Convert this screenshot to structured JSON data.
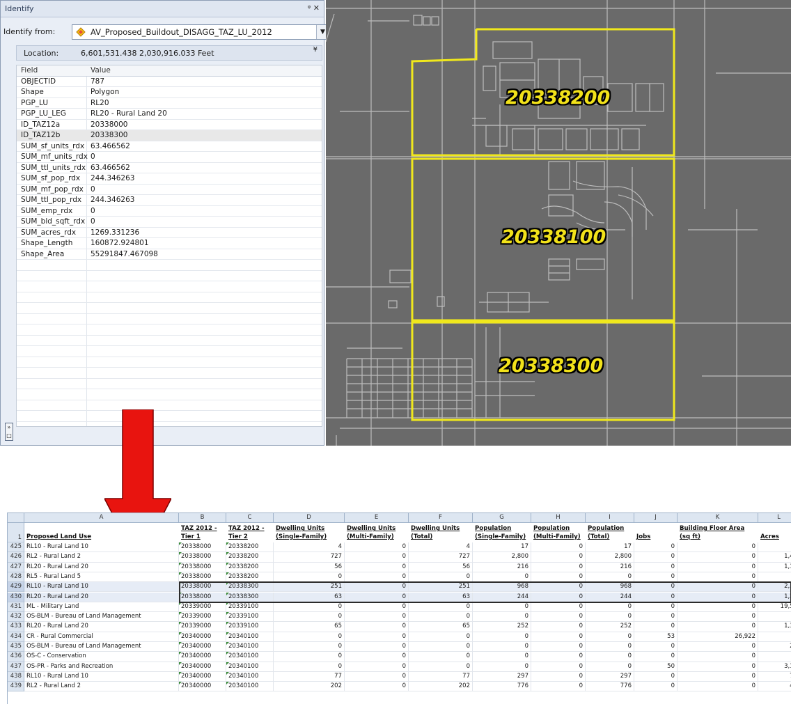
{
  "identify": {
    "title": "Identify",
    "title_buttons": " ↓ ×",
    "from_label": "Identify from:",
    "from_value": "AV_Proposed_Buildout_DISAGG_TAZ_LU_2012",
    "location_label": "Location:",
    "location_value": "6,601,531.438  2,030,916.033 Feet",
    "col_field": "Field",
    "col_value": "Value",
    "rows": [
      {
        "field": "OBJECTID",
        "value": "787"
      },
      {
        "field": "Shape",
        "value": "Polygon"
      },
      {
        "field": "PGP_LU",
        "value": "RL20"
      },
      {
        "field": "PGP_LU_LEG",
        "value": "RL20 - Rural Land 20"
      },
      {
        "field": "ID_TAZ12a",
        "value": "20338000"
      },
      {
        "field": "ID_TAZ12b",
        "value": "20338300"
      },
      {
        "field": "SUM_sf_units_rdx",
        "value": "63.466562"
      },
      {
        "field": "SUM_mf_units_rdx",
        "value": "0"
      },
      {
        "field": "SUM_ttl_units_rdx",
        "value": "63.466562"
      },
      {
        "field": "SUM_sf_pop_rdx",
        "value": "244.346263"
      },
      {
        "field": "SUM_mf_pop_rdx",
        "value": "0"
      },
      {
        "field": "SUM_ttl_pop_rdx",
        "value": "244.346263"
      },
      {
        "field": "SUM_emp_rdx",
        "value": "0"
      },
      {
        "field": "SUM_bld_sqft_rdx",
        "value": "0"
      },
      {
        "field": "SUM_acres_rdx",
        "value": "1269.331236"
      },
      {
        "field": "Shape_Length",
        "value": "160872.924801"
      },
      {
        "field": "Shape_Area",
        "value": "55291847.467098"
      }
    ],
    "selected_row_index": 5
  },
  "map": {
    "labels": [
      "20338200",
      "20338100",
      "20338300"
    ],
    "background_color": "#6a6a6a",
    "boundary_color": "#f0e81c",
    "road_color": "#bdbdbd"
  },
  "arrow": {
    "color": "#e8140f",
    "icon": "down-arrow-icon"
  },
  "spreadsheet": {
    "columns": [
      "A",
      "B",
      "C",
      "D",
      "E",
      "F",
      "G",
      "H",
      "I",
      "J",
      "K",
      "L"
    ],
    "header_row_number": "1",
    "headers": [
      [
        "",
        "Proposed Land Use"
      ],
      [
        "TAZ 2012 -",
        "Tier 1"
      ],
      [
        "TAZ 2012 -",
        "Tier 2"
      ],
      [
        "Dwelling Units",
        "(Single-Family)"
      ],
      [
        "Dwelling Units",
        "(Multi-Family)"
      ],
      [
        "Dwelling Units",
        "(Total)"
      ],
      [
        "Population",
        "(Single-Family)"
      ],
      [
        "Population",
        "(Multi-Family)"
      ],
      [
        "Population",
        "(Total)"
      ],
      [
        "",
        "Jobs"
      ],
      [
        "Building Floor Area",
        "(sq ft)"
      ],
      [
        "",
        "Acres"
      ]
    ],
    "rows": [
      {
        "n": "425",
        "c": [
          "RL10 - Rural Land 10",
          "20338000",
          "20338200",
          "4",
          "0",
          "4",
          "17",
          "0",
          "17",
          "0",
          "0",
          "4"
        ]
      },
      {
        "n": "426",
        "c": [
          "RL2 - Rural Land 2",
          "20338000",
          "20338200",
          "727",
          "0",
          "727",
          "2,800",
          "0",
          "2,800",
          "0",
          "0",
          "1,45"
        ]
      },
      {
        "n": "427",
        "c": [
          "RL20 - Rural Land 20",
          "20338000",
          "20338200",
          "56",
          "0",
          "56",
          "216",
          "0",
          "216",
          "0",
          "0",
          "1,12"
        ]
      },
      {
        "n": "428",
        "c": [
          "RL5 - Rural Land 5",
          "20338000",
          "20338200",
          "0",
          "0",
          "0",
          "0",
          "0",
          "0",
          "0",
          "0",
          ""
        ]
      },
      {
        "n": "429",
        "c": [
          "RL10 - Rural Land 10",
          "20338000",
          "20338300",
          "251",
          "0",
          "251",
          "968",
          "0",
          "968",
          "0",
          "0",
          "2,51"
        ]
      },
      {
        "n": "430",
        "c": [
          "RL20 - Rural Land 20",
          "20338000",
          "20338300",
          "63",
          "0",
          "63",
          "244",
          "0",
          "244",
          "0",
          "0",
          "1,26"
        ]
      },
      {
        "n": "431",
        "c": [
          "ML - Military Land",
          "20339000",
          "20339100",
          "0",
          "0",
          "0",
          "0",
          "0",
          "0",
          "0",
          "0",
          "19,56"
        ]
      },
      {
        "n": "432",
        "c": [
          "OS-BLM - Bureau of Land Management",
          "20339000",
          "20339100",
          "0",
          "0",
          "0",
          "0",
          "0",
          "0",
          "0",
          "0",
          ""
        ]
      },
      {
        "n": "433",
        "c": [
          "RL20 - Rural Land 20",
          "20339000",
          "20339100",
          "65",
          "0",
          "65",
          "252",
          "0",
          "252",
          "0",
          "0",
          "1,30"
        ]
      },
      {
        "n": "434",
        "c": [
          "CR - Rural Commercial",
          "20340000",
          "20340100",
          "0",
          "0",
          "0",
          "0",
          "0",
          "0",
          "53",
          "26,922",
          ""
        ]
      },
      {
        "n": "435",
        "c": [
          "OS-BLM - Bureau of Land Management",
          "20340000",
          "20340100",
          "0",
          "0",
          "0",
          "0",
          "0",
          "0",
          "0",
          "0",
          "28"
        ]
      },
      {
        "n": "436",
        "c": [
          "OS-C - Conservation",
          "20340000",
          "20340100",
          "0",
          "0",
          "0",
          "0",
          "0",
          "0",
          "0",
          "0",
          "2"
        ]
      },
      {
        "n": "437",
        "c": [
          "OS-PR - Parks and Recreation",
          "20340000",
          "20340100",
          "0",
          "0",
          "0",
          "0",
          "0",
          "0",
          "50",
          "0",
          "3,11"
        ]
      },
      {
        "n": "438",
        "c": [
          "RL10 - Rural Land 10",
          "20340000",
          "20340100",
          "77",
          "0",
          "77",
          "297",
          "0",
          "297",
          "0",
          "0",
          "77"
        ]
      },
      {
        "n": "439",
        "c": [
          "RL2 - Rural Land 2",
          "20340000",
          "20340100",
          "202",
          "0",
          "202",
          "776",
          "0",
          "776",
          "0",
          "0",
          "40"
        ]
      }
    ],
    "selected_rows": [
      "429",
      "430"
    ]
  }
}
